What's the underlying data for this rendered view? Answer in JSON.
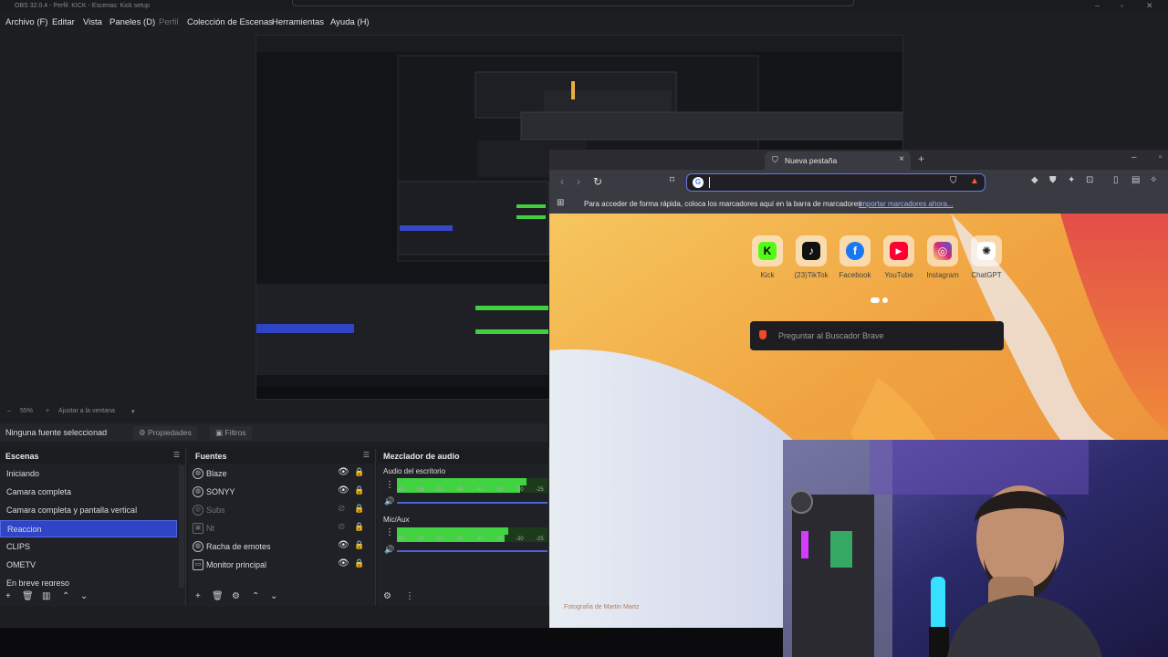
{
  "window": {
    "title": "OBS 32.0.4 - Perfil: KICK - Escenas: Kick setup"
  },
  "menu": [
    "Archivo (F)",
    "Editar",
    "Vista",
    "Paneles (D)",
    "Perfil",
    "Colección de Escenas",
    "Herramientas",
    "Ayuda (H)"
  ],
  "zoom": {
    "value": "55%",
    "fit": "Ajustar a la ventana"
  },
  "source_bar": {
    "label": "Ninguna fuente seleccionad",
    "properties": "Propiedades",
    "filters": "Filtros"
  },
  "scenes": {
    "title": "Escenas",
    "items": [
      "Iniciando",
      "Camara completa",
      "Camara completa y pantalla vertical",
      "Reaccion",
      "CLIPS",
      "OMETV",
      "En breve regreso"
    ],
    "selected": "Reaccion"
  },
  "sources": {
    "title": "Fuentes",
    "items": [
      {
        "name": "Blaze",
        "icon": "globe-icon",
        "visible": true
      },
      {
        "name": "SONYY",
        "icon": "globe-icon",
        "visible": true
      },
      {
        "name": "Subs",
        "icon": "globe-icon",
        "visible": false
      },
      {
        "name": "Nt",
        "icon": "image-icon",
        "visible": false
      },
      {
        "name": "Racha de emotes",
        "icon": "globe-icon",
        "visible": true
      },
      {
        "name": "Monitor principal",
        "icon": "monitor-icon",
        "visible": true
      }
    ]
  },
  "mixer": {
    "title": "Mezclador de audio",
    "channels": [
      {
        "name": "Audio del escritorio",
        "level": 0.86
      },
      {
        "name": "Mic/Aux",
        "level": 0.74
      }
    ],
    "ticks": [
      "-60",
      "-55",
      "-50",
      "-45",
      "-40",
      "-35",
      "-30",
      "-25"
    ]
  },
  "browser": {
    "tab_title": "Nueva pestaña",
    "url_value": "",
    "bookmark_message": "Para acceder de forma rápida, coloca los marcadores aquí en la barra de marcadores",
    "import_link": "Importar marcadores ahora...",
    "tiles": [
      {
        "label": "Kick",
        "color": "#53fc18",
        "glyph": "K"
      },
      {
        "label": "(23)TikTok",
        "color": "#111111",
        "glyph": "♪"
      },
      {
        "label": "Facebook",
        "color": "#1877f2",
        "glyph": "f"
      },
      {
        "label": "YouTube",
        "color": "#ff0033",
        "glyph": "▶"
      },
      {
        "label": "Instagram",
        "color": "#d62976",
        "glyph": "◎"
      },
      {
        "label": "ChatGPT",
        "color": "#ffffff",
        "glyph": "✺"
      }
    ],
    "search_placeholder": "Preguntar al Buscador Brave",
    "photo_credit": "Fotografía de Martin Martz"
  }
}
